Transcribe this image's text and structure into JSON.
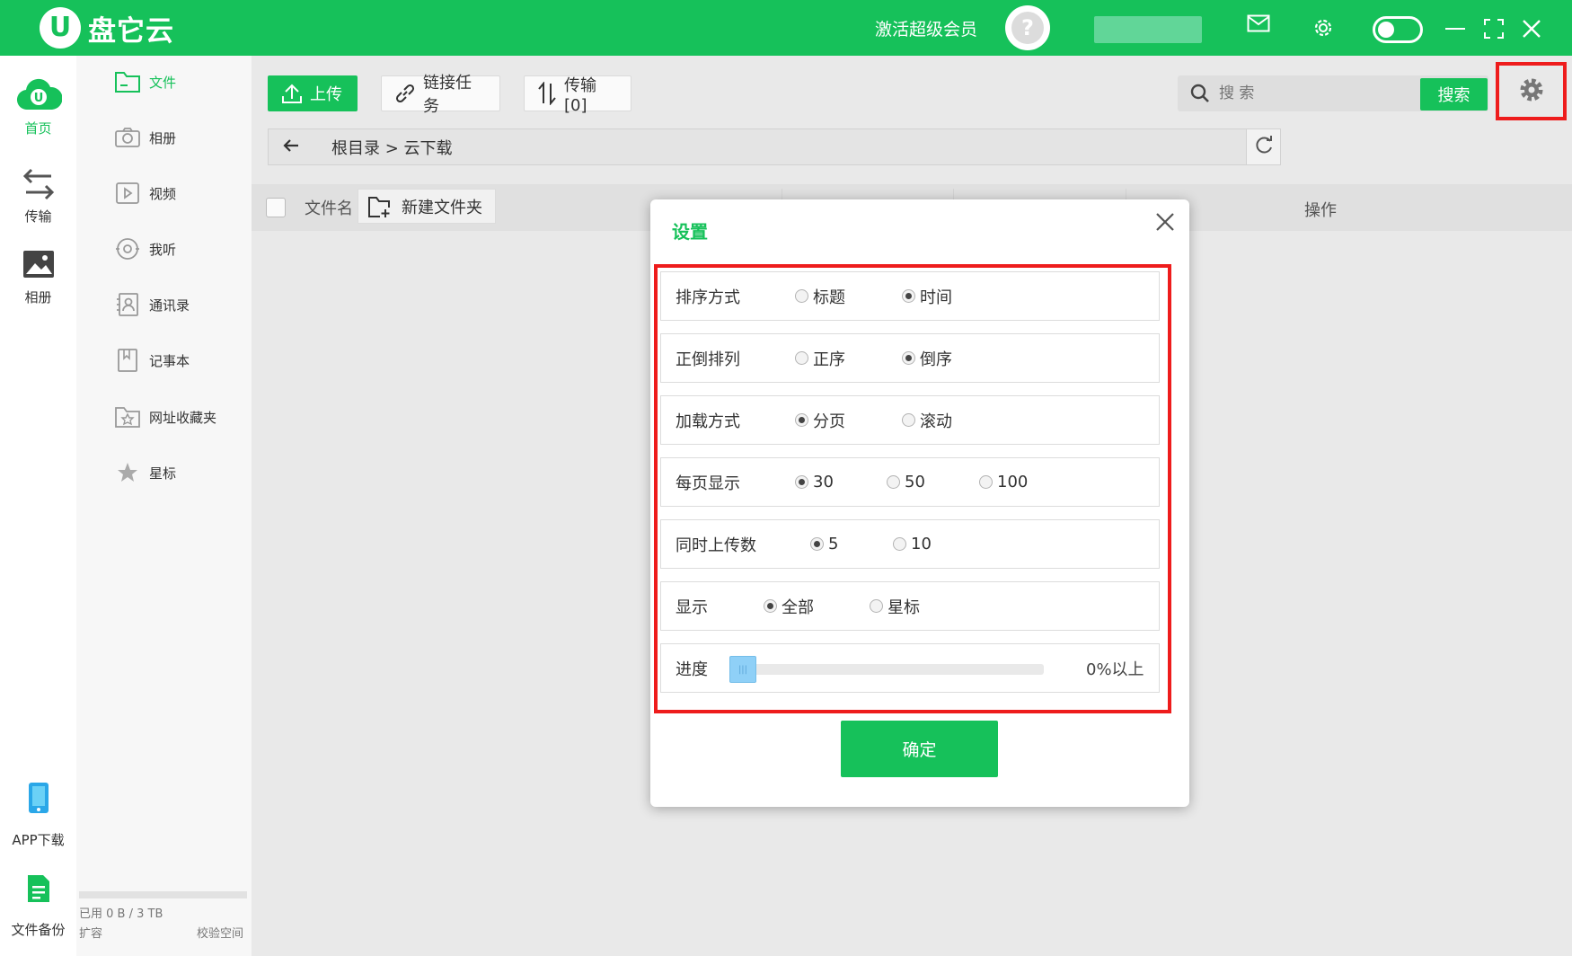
{
  "app": {
    "logo_letter": "U",
    "name": "盘它云"
  },
  "titlebar": {
    "vip_label": "激活超级会员",
    "avatar_glyph": "?"
  },
  "rail": {
    "home": "首页",
    "transfer": "传输",
    "album": "相册",
    "app_download": "APP下载",
    "backup": "文件备份"
  },
  "subnav": {
    "items": [
      "文件",
      "相册",
      "视频",
      "我听",
      "通讯录",
      "记事本",
      "网址收藏夹",
      "星标"
    ],
    "quota": "已用 0 B / 3 TB",
    "expand": "扩容",
    "verify": "校验空间"
  },
  "toolbar": {
    "upload": "上传",
    "link_task": "链接任务",
    "transfer": "传输[0]",
    "search_placeholder": "搜 索",
    "search_button": "搜索"
  },
  "path": {
    "crumb": "根目录 > 云下载"
  },
  "table": {
    "col_name": "文件名",
    "new_folder": "新建文件夹",
    "col_op": "操作"
  },
  "dialog": {
    "title": "设置",
    "rows": [
      {
        "label": "排序方式",
        "options": [
          "标题",
          "时间"
        ],
        "selected": 1
      },
      {
        "label": "正倒排列",
        "options": [
          "正序",
          "倒序"
        ],
        "selected": 1
      },
      {
        "label": "加载方式",
        "options": [
          "分页",
          "滚动"
        ],
        "selected": 0
      },
      {
        "label": "每页显示",
        "options": [
          "30",
          "50",
          "100"
        ],
        "selected": 0
      },
      {
        "label": "同时上传数",
        "options": [
          "5",
          "10"
        ],
        "selected": 0
      },
      {
        "label": "显示",
        "options": [
          "全部",
          "星标"
        ],
        "selected": 0
      }
    ],
    "progress": {
      "label": "进度",
      "value_text": "0%以上",
      "fraction": 0
    },
    "confirm": "确定"
  },
  "colors": {
    "accent": "#16c15a",
    "highlight": "#ee1c1c"
  }
}
